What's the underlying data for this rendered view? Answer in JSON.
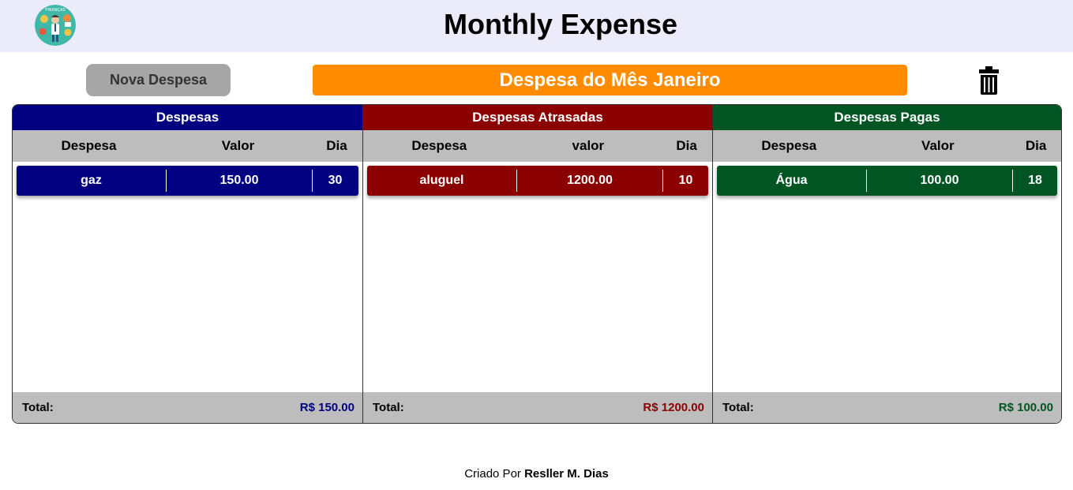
{
  "app": {
    "title": "Monthly Expense",
    "logo_label": "FINANÇAS"
  },
  "toolbar": {
    "new_expense_label": "Nova Despesa",
    "month_banner": "Despesa do Mês Janeiro"
  },
  "columns": [
    {
      "title": "Despesas",
      "color": "#000080",
      "headers": [
        "Despesa",
        "Valor",
        "Dia"
      ],
      "rows": [
        {
          "name": "gaz",
          "value": "150.00",
          "day": "30"
        }
      ],
      "total_label": "Total:",
      "total_value": "R$ 150.00"
    },
    {
      "title": "Despesas Atrasadas",
      "color": "#8b0000",
      "headers": [
        "Despesa",
        "valor",
        "Dia"
      ],
      "rows": [
        {
          "name": "aluguel",
          "value": "1200.00",
          "day": "10"
        }
      ],
      "total_label": "Total:",
      "total_value": "R$ 1200.00"
    },
    {
      "title": "Despesas Pagas",
      "color": "#005522",
      "headers": [
        "Despesa",
        "Valor",
        "Dia"
      ],
      "rows": [
        {
          "name": "Água",
          "value": "100.00",
          "day": "18"
        }
      ],
      "total_label": "Total:",
      "total_value": "R$ 100.00"
    }
  ],
  "footer": {
    "prefix": "Criado Por",
    "author": "Resller M. Dias"
  },
  "colors": {
    "header_bg": "#ebebfa",
    "banner": "#ff8c00",
    "button": "#a6a6a6",
    "table_head": "#bdbdbd"
  },
  "icons": {
    "logo": "finance-logo-icon",
    "delete": "trash-icon"
  }
}
